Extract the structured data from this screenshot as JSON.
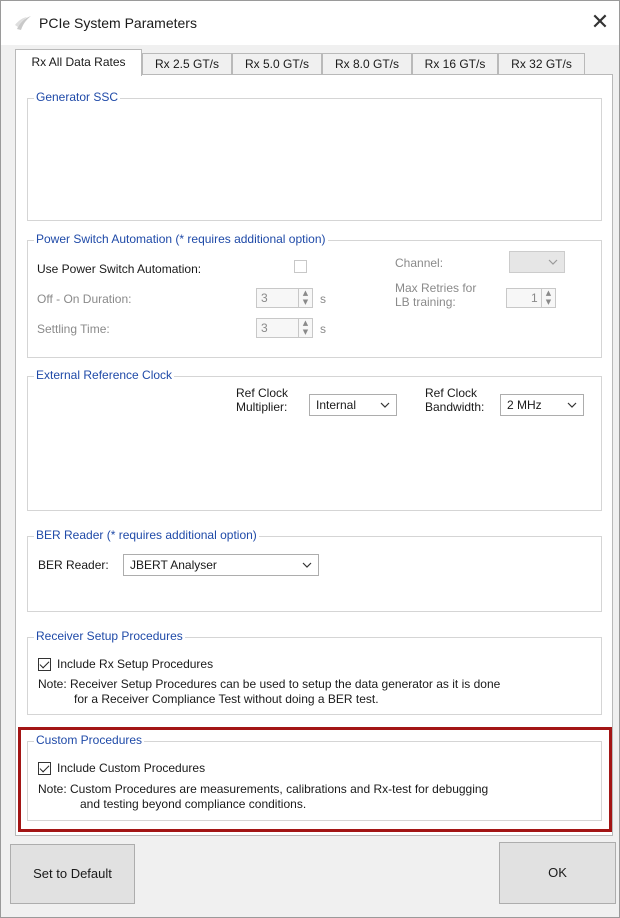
{
  "window": {
    "title": "PCIe System Parameters",
    "icon": "app-logo-icon",
    "close_icon": "close-icon"
  },
  "tabs": [
    {
      "label": "Rx All Data Rates",
      "active": true
    },
    {
      "label": "Rx 2.5 GT/s"
    },
    {
      "label": "Rx 5.0 GT/s"
    },
    {
      "label": "Rx 8.0 GT/s"
    },
    {
      "label": "Rx 16 GT/s"
    },
    {
      "label": "Rx 32 GT/s"
    }
  ],
  "generator_ssc": {
    "title": "Generator SSC"
  },
  "power_switch": {
    "title": "Power Switch Automation (* requires additional option)",
    "use_label": "Use Power Switch Automation:",
    "use_checked": false,
    "off_on_label": "Off - On Duration:",
    "off_on_value": "3",
    "off_on_unit": "s",
    "settling_label": "Settling Time:",
    "settling_value": "3",
    "settling_unit": "s",
    "channel_label": "Channel:",
    "channel_value": "",
    "max_retries_label_1": "Max Retries for",
    "max_retries_label_2": "LB training:",
    "max_retries_value": "1"
  },
  "ext_ref_clock": {
    "title": "External Reference Clock",
    "multiplier_label_1": "Ref Clock",
    "multiplier_label_2": "Multiplier:",
    "multiplier_value": "Internal",
    "bandwidth_label_1": "Ref Clock",
    "bandwidth_label_2": "Bandwidth:",
    "bandwidth_value": "2 MHz"
  },
  "ber_reader": {
    "title": "BER Reader (* requires additional option)",
    "label": "BER Reader:",
    "value": "JBERT Analyser"
  },
  "receiver_setup": {
    "title": "Receiver Setup Procedures",
    "checkbox_label": "Include Rx Setup Procedures",
    "checked": true,
    "note_1": "Note: Receiver Setup Procedures can be used to setup the data generator as it is done",
    "note_2": "for a Receiver Compliance Test without doing a BER test."
  },
  "custom_procedures": {
    "title": "Custom Procedures",
    "checkbox_label": "Include Custom Procedures",
    "checked": true,
    "note_1": "Note:  Custom Procedures are measurements, calibrations and Rx-test for debugging",
    "note_2": "and testing beyond compliance conditions.",
    "highlight_color": "#a31515"
  },
  "buttons": {
    "set_default": "Set to Default",
    "ok": "OK"
  }
}
